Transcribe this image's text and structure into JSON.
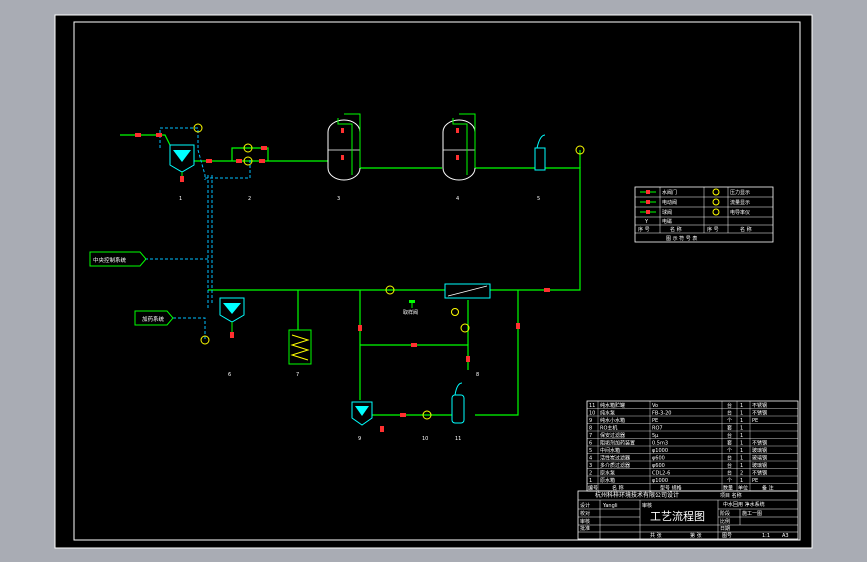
{
  "colors": {
    "workspace": "#a9acb4",
    "paper": "#000000",
    "border": "#ffffff",
    "pipe": "#00ff00",
    "signal": "#00bfff",
    "valve": "#ff3030",
    "instrument": "#ffff00",
    "equipment": "#00ffff",
    "text": "#ffffff"
  },
  "callouts": {
    "control_system": "中央控制系统",
    "dosing_system": "加药系统"
  },
  "equipment_numbers": {
    "n1": "1",
    "n2": "2",
    "n3": "3",
    "n4": "4",
    "n5": "5",
    "n6": "6",
    "n7": "7",
    "n8": "8",
    "n9": "9",
    "n10": "10",
    "n11": "11"
  },
  "instruments": {
    "sampling_label": "取样阀"
  },
  "legend": {
    "rows": [
      {
        "left_label": "水阀门",
        "right_label": "压力显示"
      },
      {
        "left_label": "电动阀",
        "right_label": "流量显示"
      },
      {
        "left_label": "球阀",
        "right_label": "电导率仪"
      },
      {
        "left_label": "Y",
        "right_label": "电磁"
      }
    ],
    "header_cells": [
      "序 号",
      "名 称",
      "序 号",
      "名 称"
    ],
    "caption": "图 示 符 号 表"
  },
  "parts_list": {
    "rows": [
      {
        "no": "11",
        "name": "纯水箱贮罐",
        "spec": "Vo",
        "qty": "1",
        "unit": "台",
        "note": "不锈钢"
      },
      {
        "no": "10",
        "name": "纯水泵",
        "spec": "FB-3-20",
        "qty": "1",
        "unit": "台",
        "note": "不锈钢"
      },
      {
        "no": "9",
        "name": "纯水小水箱",
        "spec": "PE",
        "qty": "1",
        "unit": "个",
        "note": "PE"
      },
      {
        "no": "8",
        "name": "RO主机",
        "spec": "RO7",
        "qty": "1",
        "unit": "套",
        "note": ""
      },
      {
        "no": "7",
        "name": "保安过滤器",
        "spec": "5μ",
        "qty": "1",
        "unit": "台",
        "note": ""
      },
      {
        "no": "6",
        "name": "阻垢剂加药装置",
        "spec": "0.5m3",
        "qty": "1",
        "unit": "套",
        "note": "不锈钢"
      },
      {
        "no": "5",
        "name": "中间水箱",
        "spec": "φ1000",
        "qty": "1",
        "unit": "个",
        "note": "玻璃钢"
      },
      {
        "no": "4",
        "name": "活性炭过滤器",
        "spec": "φ600",
        "qty": "1",
        "unit": "台",
        "note": "玻璃钢"
      },
      {
        "no": "3",
        "name": "多介质过滤器",
        "spec": "φ600",
        "qty": "1",
        "unit": "台",
        "note": "玻璃钢"
      },
      {
        "no": "2",
        "name": "原水泵",
        "spec": "CDL2-6",
        "qty": "2",
        "unit": "台",
        "note": "不锈钢"
      },
      {
        "no": "1",
        "name": "原水箱",
        "spec": "φ1000",
        "qty": "1",
        "unit": "个",
        "note": "PE"
      }
    ],
    "header": {
      "no": "编号",
      "name": "名  称",
      "spec": "型号 规格",
      "qty": "数量",
      "unit": "单位",
      "note": "备  注"
    }
  },
  "title_block": {
    "company": "杭州科梓环境技术有限公司设计",
    "project_label_1": "项目 名称",
    "project_value_1": "中水回用 净水系统",
    "drawing_title": "工艺流程图",
    "designer": "Yangli",
    "check_label": "审核",
    "stage_label": "阶段",
    "stage_value": "施工一图",
    "sheet_label": "比例",
    "date_label": "日期",
    "row_labels": [
      "设计",
      "校对",
      "审核",
      "批准"
    ],
    "bottom_labels": [
      "共  张",
      "第  张",
      "图号"
    ],
    "scale": "1:1",
    "drawing_no": "A3"
  }
}
